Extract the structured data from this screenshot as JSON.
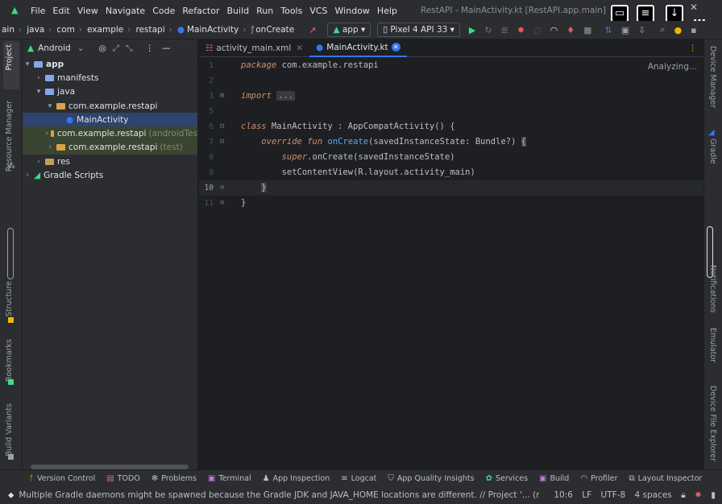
{
  "menubar": {
    "items": [
      "File",
      "Edit",
      "View",
      "Navigate",
      "Code",
      "Refactor",
      "Build",
      "Run",
      "Tools",
      "VCS",
      "Window",
      "Help"
    ],
    "title": "RestAPI - MainActivity.kt [RestAPI.app.main]"
  },
  "navbar": {
    "breadcrumbs": [
      "ain",
      "java",
      "com",
      "example",
      "restapi",
      "MainActivity",
      "onCreate"
    ],
    "run_config": "app",
    "device": "Pixel 4 API 33"
  },
  "left_stripe": {
    "tabs_top": [
      "Project",
      "Resource Manager"
    ],
    "tabs_bottom": [
      "Structure",
      "Bookmarks",
      "Build Variants"
    ]
  },
  "project": {
    "view_mode": "Android",
    "tree": [
      {
        "label": "app",
        "muted": "",
        "depth": 0,
        "arrow": "▾",
        "icon": "module"
      },
      {
        "label": "manifests",
        "muted": "",
        "depth": 1,
        "arrow": "›",
        "icon": "folder"
      },
      {
        "label": "java",
        "muted": "",
        "depth": 1,
        "arrow": "▾",
        "icon": "folder"
      },
      {
        "label": "com.example.restapi",
        "muted": "",
        "depth": 2,
        "arrow": "▾",
        "icon": "package"
      },
      {
        "label": "MainActivity",
        "muted": "",
        "depth": 3,
        "arrow": "",
        "icon": "kotlin"
      },
      {
        "label": "com.example.restapi",
        "muted": "(androidTes",
        "depth": 2,
        "arrow": "›",
        "icon": "package"
      },
      {
        "label": "com.example.restapi",
        "muted": "(test)",
        "depth": 2,
        "arrow": "›",
        "icon": "package"
      },
      {
        "label": "res",
        "muted": "",
        "depth": 1,
        "arrow": "›",
        "icon": "folder"
      },
      {
        "label": "Gradle Scripts",
        "muted": "",
        "depth": 0,
        "arrow": "›",
        "icon": "gradle"
      }
    ]
  },
  "tabs": [
    {
      "label": "activity_main.xml",
      "active": false
    },
    {
      "label": "MainActivity.kt",
      "active": true
    }
  ],
  "editor": {
    "status": "Analyzing...",
    "line_numbers": [
      "1",
      "2",
      "3",
      "5",
      "6",
      "7",
      "8",
      "9",
      "10",
      "11"
    ],
    "lines": {
      "l1a": "package",
      "l1b": " com.example.restapi",
      "l3a": "import",
      "l3b": "...",
      "l6a": "class",
      "l6b": " MainActivity : ",
      "l6c": "AppCompatActivity",
      "l6d": "() {",
      "l7a": "override",
      "l7b": "fun",
      "l7c": "onCreate",
      "l7d": "(savedInstanceState: Bundle?) ",
      "l7e": "{",
      "l8a": "super",
      "l8b": ".onCreate(savedInstanceState)",
      "l9": "setContentView(R.layout.activity_main)",
      "l10": "}",
      "l11": "}"
    }
  },
  "right_stripe": {
    "tabs": [
      "Device Manager",
      "Gradle",
      "Notifications",
      "Emulator",
      "Device File Explorer"
    ]
  },
  "tool_windows": [
    "Version Control",
    "TODO",
    "Problems",
    "Terminal",
    "App Inspection",
    "Logcat",
    "App Quality Insights",
    "Services",
    "Build",
    "Profiler",
    "Layout Inspector"
  ],
  "status": {
    "message": "Multiple Gradle daemons might be spawned because the Gradle JDK and JAVA_HOME locations are different. // Project '... (moments ag",
    "position": "10:6",
    "line_sep": "LF",
    "encoding": "UTF-8",
    "indent": "4 spaces"
  },
  "colors": {
    "accent": "#3574f0",
    "android_green": "#3ddc84",
    "keyword": "#cf8e6d",
    "function": "#56a8f5"
  }
}
